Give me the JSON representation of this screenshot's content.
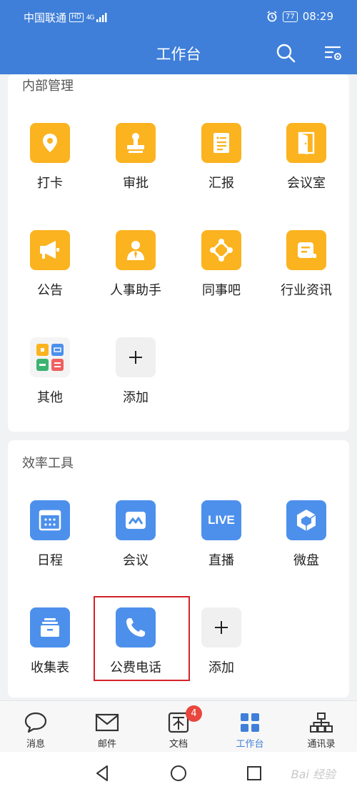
{
  "status_bar": {
    "carrier": "中国联通",
    "hd": "HD",
    "network": "4G",
    "battery": "77",
    "time": "08:29"
  },
  "header": {
    "title": "工作台",
    "search_icon": "search-icon",
    "settings_icon": "list-settings-icon"
  },
  "sections": [
    {
      "title": "内部管理",
      "items": [
        {
          "label": "打卡",
          "icon": "location-pin-icon"
        },
        {
          "label": "审批",
          "icon": "stamp-icon"
        },
        {
          "label": "汇报",
          "icon": "document-icon"
        },
        {
          "label": "会议室",
          "icon": "door-icon"
        },
        {
          "label": "公告",
          "icon": "megaphone-icon"
        },
        {
          "label": "人事助手",
          "icon": "person-tie-icon"
        },
        {
          "label": "同事吧",
          "icon": "network-nodes-icon"
        },
        {
          "label": "行业资讯",
          "icon": "news-icon"
        },
        {
          "label": "其他",
          "icon": "app-grid-icon"
        },
        {
          "label": "添加",
          "icon": "plus-icon"
        }
      ]
    },
    {
      "title": "效率工具",
      "items": [
        {
          "label": "日程",
          "icon": "calendar-icon"
        },
        {
          "label": "会议",
          "icon": "meeting-icon"
        },
        {
          "label": "直播",
          "icon": "live-icon",
          "icon_text": "LIVE"
        },
        {
          "label": "微盘",
          "icon": "cloud-disk-icon"
        },
        {
          "label": "收集表",
          "icon": "stack-form-icon"
        },
        {
          "label": "公费电话",
          "icon": "phone-icon"
        },
        {
          "label": "添加",
          "icon": "plus-icon"
        }
      ]
    }
  ],
  "tabbar": {
    "items": [
      {
        "label": "消息",
        "icon": "chat-bubble-icon"
      },
      {
        "label": "邮件",
        "icon": "mail-icon"
      },
      {
        "label": "文档",
        "icon": "doc-icon",
        "badge": "4"
      },
      {
        "label": "工作台",
        "icon": "grid-icon",
        "active": true
      },
      {
        "label": "通讯录",
        "icon": "org-chart-icon"
      }
    ]
  },
  "nav": {
    "back": "back-icon",
    "home": "home-icon",
    "recent": "recent-apps-icon"
  },
  "colors": {
    "primary": "#3f7fd9",
    "yellow": "#fbb31f",
    "blue": "#4d90ec",
    "highlight": "#d3222a",
    "badge": "#e9463d"
  },
  "watermark": "Bai 经验"
}
